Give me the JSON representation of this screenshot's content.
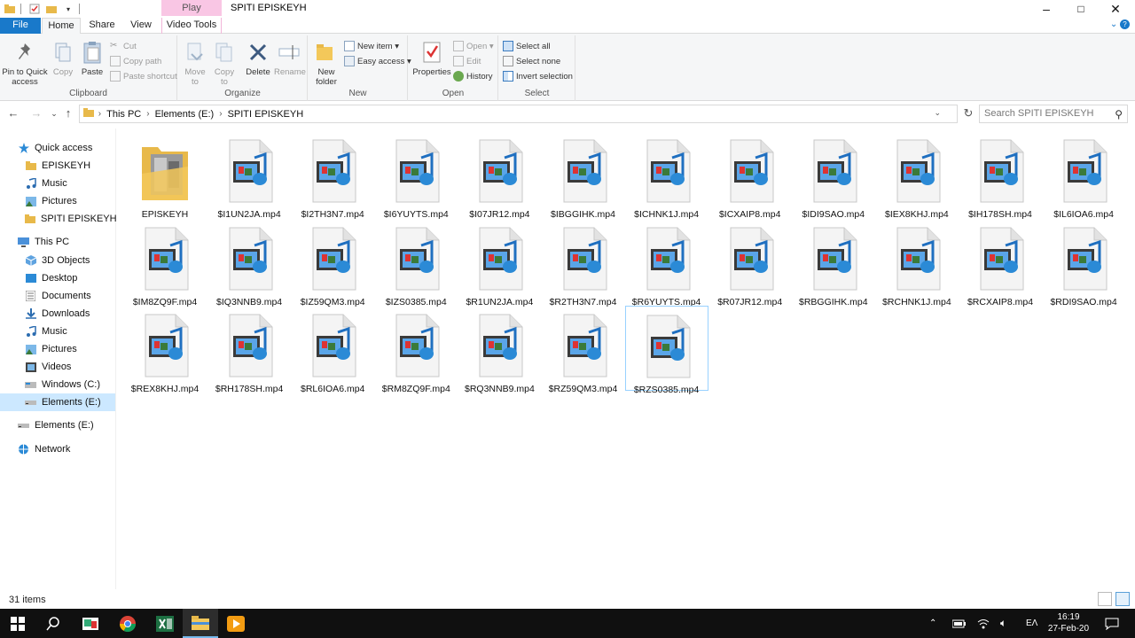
{
  "window": {
    "title": "SPITI EPISKEYH",
    "contextual_tab": "Play",
    "controls": {
      "minimize": "–",
      "maximize": "□",
      "close": "✕"
    }
  },
  "tabs": [
    "File",
    "Home",
    "Share",
    "View",
    "Video Tools"
  ],
  "ribbon": {
    "clipboard": {
      "label": "Clipboard",
      "pin": "Pin to Quick access",
      "copy": "Copy",
      "paste": "Paste",
      "cut": "Cut",
      "copy_path": "Copy path",
      "paste_shortcut": "Paste shortcut"
    },
    "organize": {
      "label": "Organize",
      "move_to": "Move to",
      "copy_to": "Copy to",
      "delete": "Delete",
      "rename": "Rename"
    },
    "new": {
      "label": "New",
      "new_folder": "New folder",
      "new_item": "New item",
      "easy_access": "Easy access"
    },
    "open": {
      "label": "Open",
      "properties": "Properties",
      "open": "Open",
      "edit": "Edit",
      "history": "History"
    },
    "select": {
      "label": "Select",
      "select_all": "Select all",
      "select_none": "Select none",
      "invert_selection": "Invert selection"
    }
  },
  "address": {
    "crumbs": [
      "This PC",
      "Elements (E:)",
      "SPITI EPISKEYH"
    ],
    "search_placeholder": "Search SPITI EPISKEYH"
  },
  "navpane": {
    "quick_access": "Quick access",
    "quick_items": [
      "EPISKEYH",
      "Music",
      "Pictures",
      "SPITI EPISKEYH"
    ],
    "this_pc": "This PC",
    "pc_items": [
      "3D Objects",
      "Desktop",
      "Documents",
      "Downloads",
      "Music",
      "Pictures",
      "Videos",
      "Windows (C:)",
      "Elements (E:)"
    ],
    "drive": "Elements (E:)",
    "network": "Network"
  },
  "files": [
    "EPISKEYH",
    "$I1UN2JA.mp4",
    "$I2TH3N7.mp4",
    "$I6YUYTS.mp4",
    "$I07JR12.mp4",
    "$IBGGIHK.mp4",
    "$ICHNK1J.mp4",
    "$ICXAIP8.mp4",
    "$IDI9SAO.mp4",
    "$IEX8KHJ.mp4",
    "$IH178SH.mp4",
    "$IL6IOA6.mp4",
    "$IM8ZQ9F.mp4",
    "$IQ3NNB9.mp4",
    "$IZ59QM3.mp4",
    "$IZS0385.mp4",
    "$R1UN2JA.mp4",
    "$R2TH3N7.mp4",
    "$R6YUYTS.mp4",
    "$R07JR12.mp4",
    "$RBGGIHK.mp4",
    "$RCHNK1J.mp4",
    "$RCXAIP8.mp4",
    "$RDI9SAO.mp4",
    "$REX8KHJ.mp4",
    "$RH178SH.mp4",
    "$RL6IOA6.mp4",
    "$RM8ZQ9F.mp4",
    "$RQ3NNB9.mp4",
    "$RZ59QM3.mp4",
    "$RZS0385.mp4"
  ],
  "status": {
    "items": "31 items"
  },
  "taskbar": {
    "lang": "EΛ",
    "time": "16:19",
    "date": "27-Feb-20"
  },
  "colors": {
    "accent": "#1979ca",
    "selection": "#cce8ff",
    "play_tab": "#f9c6e4"
  }
}
